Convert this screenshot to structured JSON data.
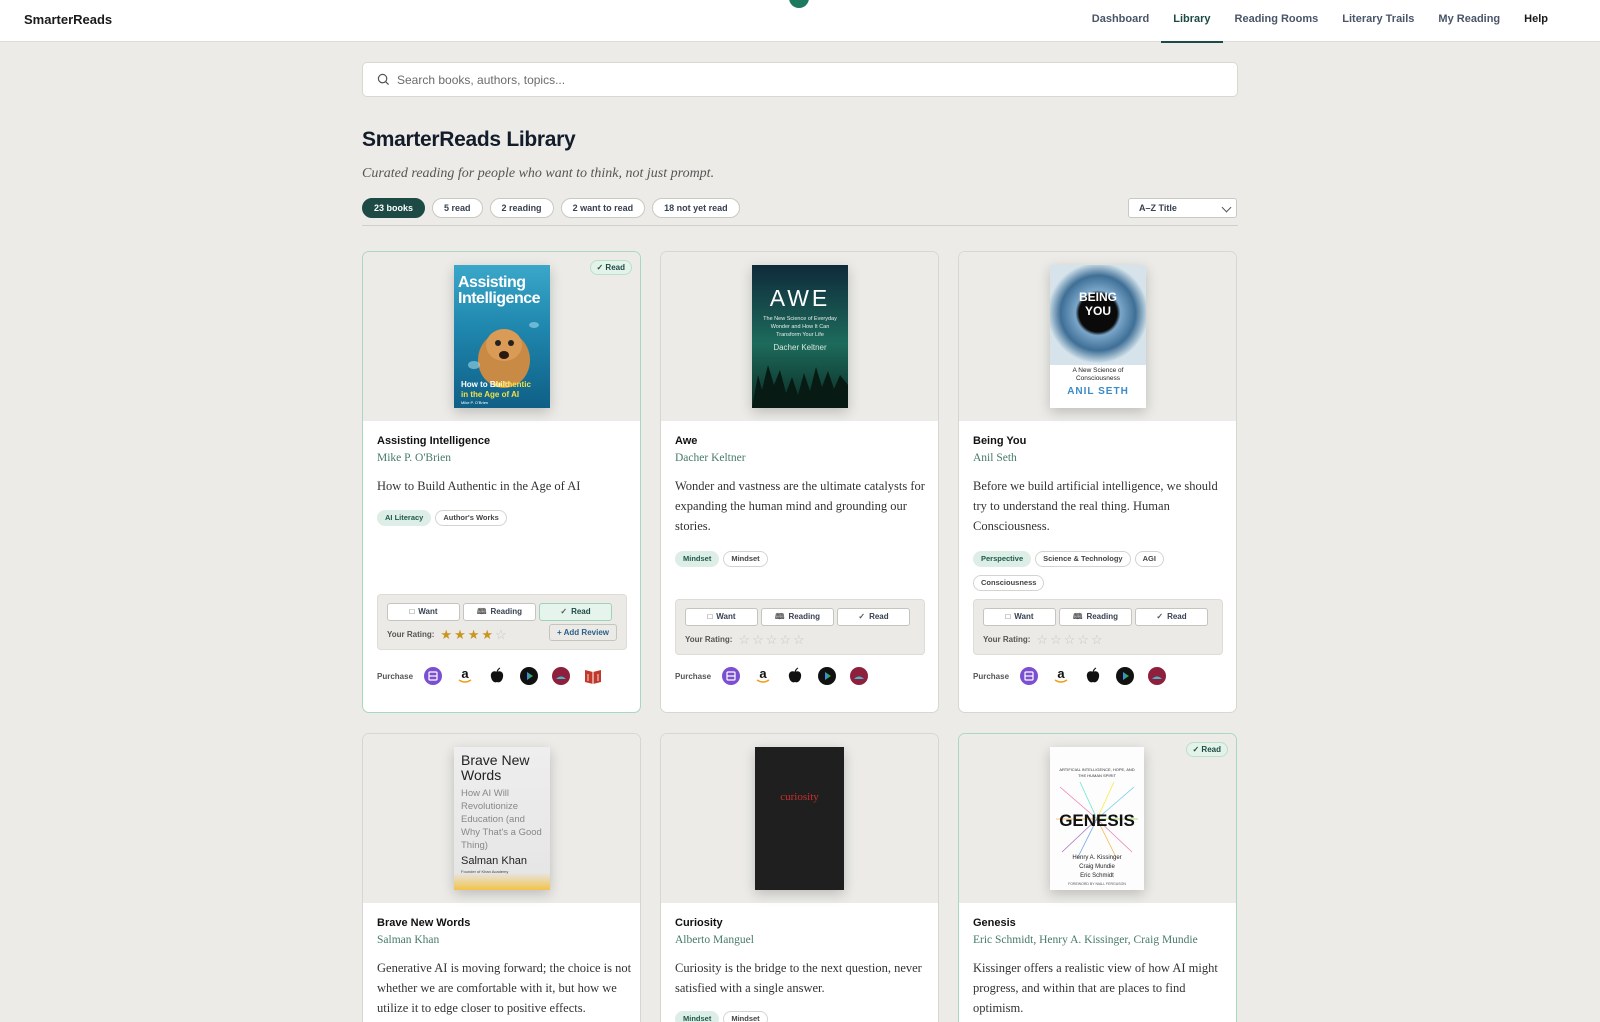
{
  "app": {
    "brand": "SmarterReads",
    "nav": [
      "Dashboard",
      "Library",
      "Reading Rooms",
      "Literary Trails",
      "My Reading",
      "Help"
    ],
    "active_nav": "Library"
  },
  "search": {
    "placeholder": "Search books, authors, topics..."
  },
  "library": {
    "title": "SmarterReads Library",
    "subtitle": "Curated reading for people who want to think, not just prompt.",
    "filters": [
      "23 books",
      "5 read",
      "2 reading",
      "2 want to read",
      "18 not yet read"
    ],
    "sort": "A–Z Title"
  },
  "labels": {
    "want": "Want",
    "reading": "Reading",
    "read": "Read",
    "your_rating": "Your Rating:",
    "add_review": "+ Add Review",
    "purchase": "Purchase",
    "read_badge": "✓ Read"
  },
  "books": [
    {
      "title": "Assisting Intelligence",
      "author": "Mike P. O'Brien",
      "description": "How to Build Authentic in the Age of AI",
      "tags": [
        "AI Literacy",
        "Author's Works"
      ],
      "status": "Read",
      "rating": 4,
      "cover_text": {
        "title": "Assisting Intelligence",
        "subtitle_a": "How to Build",
        "subtitle_b": "Authentic",
        "subtitle_c": "in the Age of AI",
        "author": "Mike P. O'Brien"
      }
    },
    {
      "title": "Awe",
      "author": "Dacher Keltner",
      "description": "Wonder and vastness are the ultimate catalysts for expanding the human mind and grounding our stories.",
      "tags": [
        "Mindset",
        "Mindset"
      ],
      "status": "none",
      "rating": 0,
      "cover_text": {
        "title": "AWE",
        "subtitle": "The New Science of Everyday Wonder and How It Can Transform Your Life",
        "author": "Dacher Keltner"
      }
    },
    {
      "title": "Being You",
      "author": "Anil Seth",
      "description": "Before we build artificial intelligence, we should try to understand the real thing. Human Consciousness.",
      "tags": [
        "Perspective",
        "Science & Technology",
        "AGI",
        "Consciousness"
      ],
      "status": "none",
      "rating": 0,
      "cover_text": {
        "title_a": "BEING",
        "title_b": "YOU",
        "subtitle": "A New Science of Consciousness",
        "author": "ANIL SETH"
      }
    },
    {
      "title": "Brave New Words",
      "author": "Salman Khan",
      "description": "Generative AI is moving forward; the choice is not whether we are comfortable with it, but how we utilize it to edge closer to positive effects.",
      "cover_text": {
        "title": "Brave New Words",
        "subtitle": "How AI Will Revolutionize Education (and Why That's a Good Thing)",
        "author": "Salman Khan",
        "author_note": "Founder of Khan Academy"
      }
    },
    {
      "title": "Curiosity",
      "author": "Alberto Manguel",
      "description": "Curiosity is the bridge to the next question, never satisfied with a single answer.",
      "tags": [
        "Mindset",
        "Mindset"
      ],
      "cover_text": {
        "title": "curiosity"
      }
    },
    {
      "title": "Genesis",
      "author": "Eric Schmidt, Henry A. Kissinger, Craig Mundie",
      "description": "Kissinger offers a realistic view of how AI might progress, and within that are places to find optimism.",
      "status": "Read",
      "cover_text": {
        "subtitle": "ARTIFICIAL INTELLIGENCE, HOPE, AND THE HUMAN SPIRIT",
        "title": "GENESIS",
        "author_a": "Henry A. Kissinger",
        "author_b": "Craig Mundie",
        "author_c": "Eric Schmidt",
        "foreword": "FOREWORD BY NIALL FERGUSON"
      }
    }
  ],
  "colors": {
    "accent": "#1d4a44",
    "star": "#c8951e",
    "read_border": "#a8d8bf"
  },
  "icons": [
    "search-icon",
    "bookmark-icon",
    "book-open-icon",
    "check-icon",
    "star-icon",
    "bookshop-icon",
    "amazon-icon",
    "apple-books-icon",
    "google-play-icon",
    "kobo-icon",
    "library-icon"
  ]
}
